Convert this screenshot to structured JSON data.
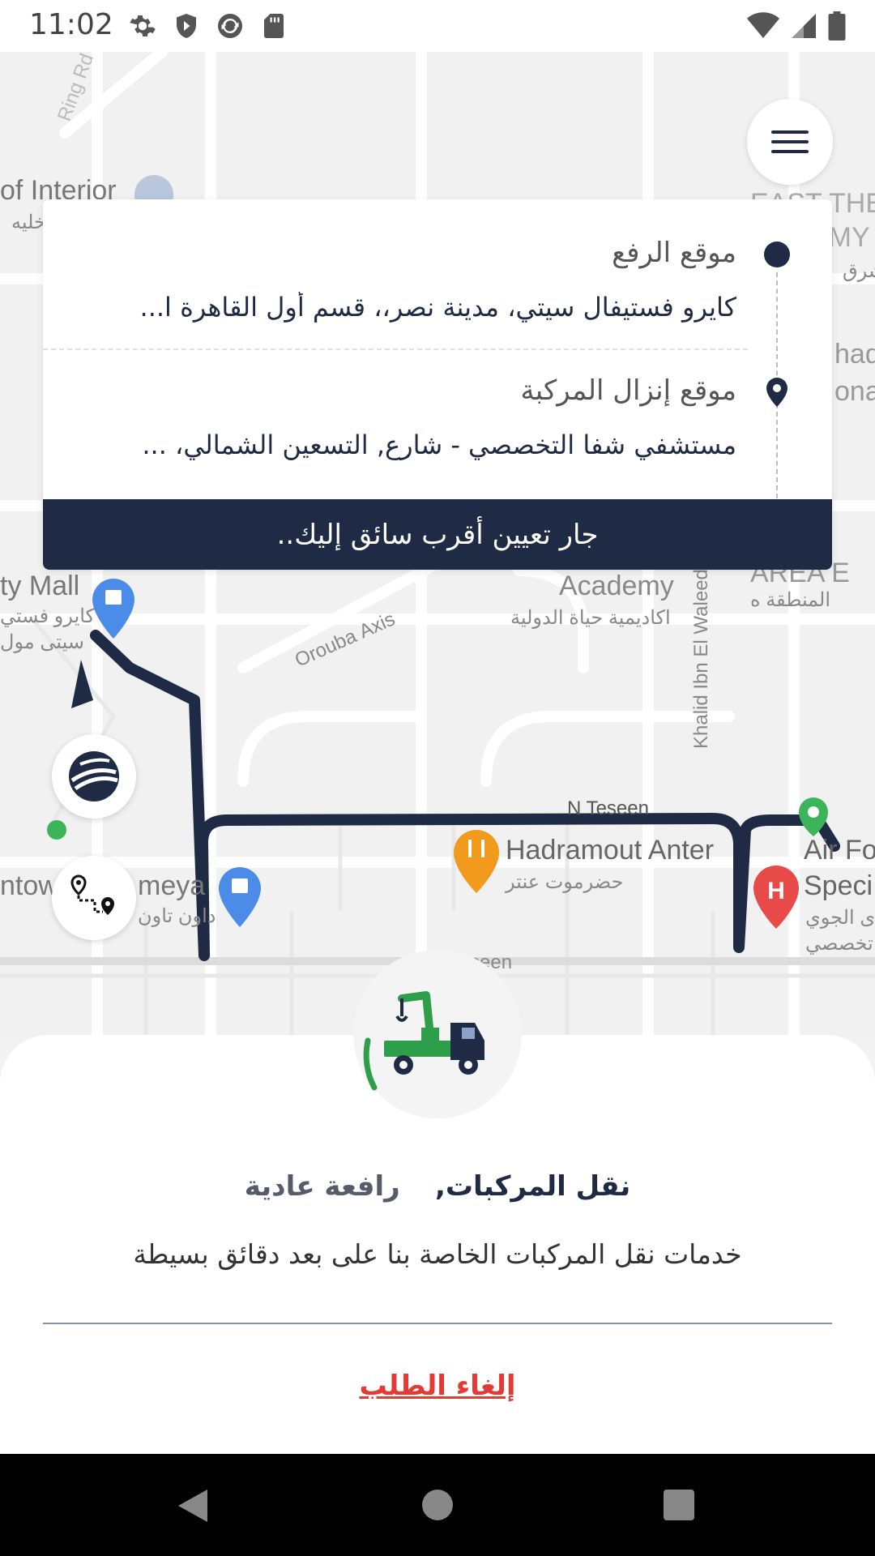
{
  "status_bar": {
    "time": "11:02",
    "icons": [
      "settings-icon",
      "shield-icon",
      "sync-icon",
      "sd-card-icon"
    ],
    "right_icons": [
      "wifi-icon",
      "signal-icon",
      "battery-icon"
    ]
  },
  "map": {
    "labels": {
      "interior": "of Interior",
      "interior_ar": "خليه",
      "east_the": "EAST THE",
      "emy": "EMY",
      "sharq": "شرق",
      "hadi": "hadi",
      "ona": "ona",
      "city_mall": "ty Mall",
      "city_mall_ar1": "كايرو فستي",
      "city_mall_ar2": "سيتى مول",
      "academy": "Academy",
      "academy_ar": "اكاديمية حياة الدولية",
      "area_e": "AREA E",
      "area_e_ar": "المنطقة ه",
      "orouba": "Oroubа Axis",
      "khalid": "Khalid Ibn El Waleed",
      "n_teseen": "N Teseen",
      "hadramout": "Hadramout Anter",
      "hadramout_ar": "حضرموت عنتر",
      "downtown": "ntow",
      "meya": "meya",
      "downtown_ar": "داون تاون",
      "air_force": "Air Fo",
      "speci": "Speci",
      "air_force_ar1": "ى الجوي",
      "air_force_ar2": "تخصصي",
      "teseen_bottom": "seen",
      "ring_road": "Ring Rd"
    }
  },
  "pickup": {
    "title": "موقع الرفع",
    "address": "كايرو فستيفال سيتي، مدينة نصر،، قسم أول القاهرة ا..."
  },
  "dropoff": {
    "title": "موقع إنزال المركبة",
    "address": "مستشفي شفا التخصصي - شارع, التسعين الشمالي، ..."
  },
  "assign_status": "جار تعيين أقرب سائق إليك..",
  "service": {
    "category": "نقل المركبات,",
    "type": "رافعة عادية",
    "description": "خدمات نقل المركبات الخاصة بنا على بعد دقائق بسيطة"
  },
  "cancel_label": "إلغاء الطلب",
  "colors": {
    "primary": "#1f2a44",
    "accent_green": "#2e9e4a",
    "danger": "#e53935"
  }
}
